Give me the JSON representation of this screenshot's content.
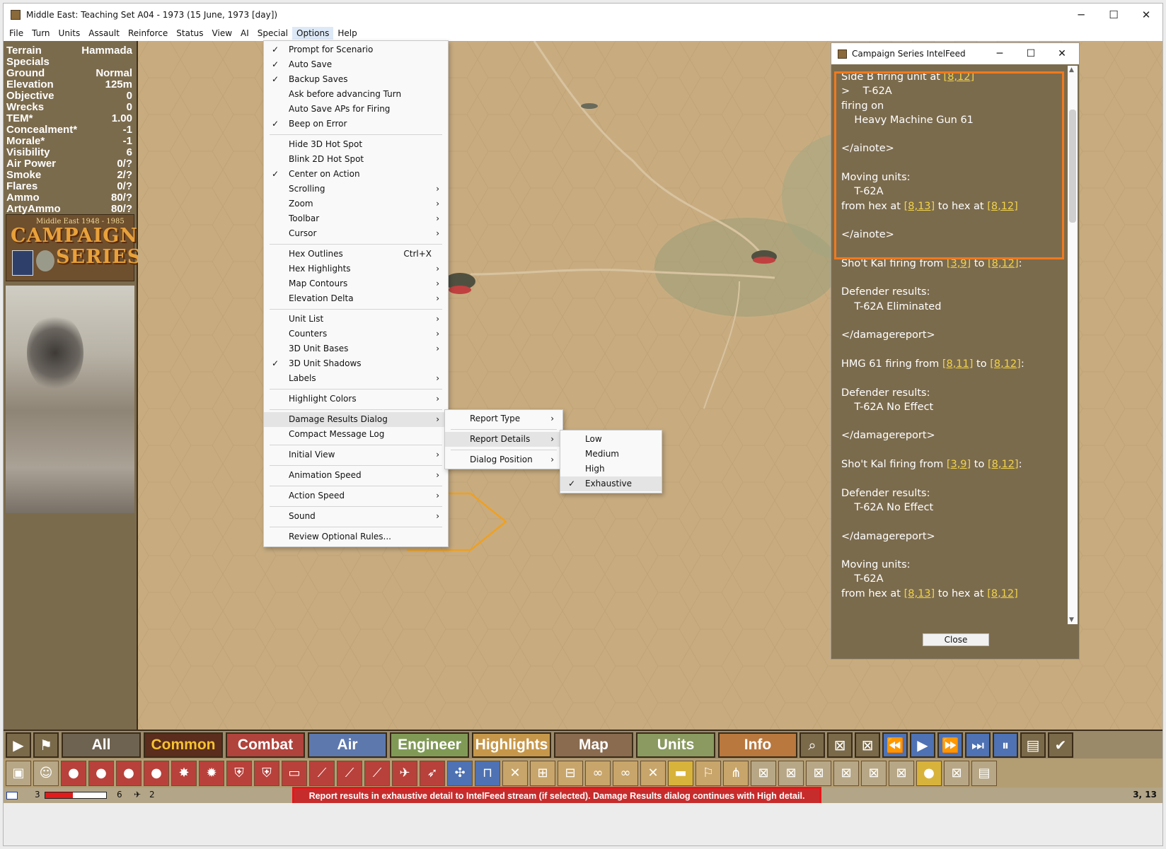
{
  "window": {
    "title": "Middle East: Teaching Set A04 - 1973 (15 June, 1973 [day])",
    "buttons": [
      "─",
      "☐",
      "✕"
    ]
  },
  "menubar": [
    "File",
    "Turn",
    "Units",
    "Assault",
    "Reinforce",
    "Status",
    "View",
    "AI",
    "Special",
    "Options",
    "Help"
  ],
  "stats": [
    {
      "label": "Terrain",
      "value": "Hammada"
    },
    {
      "label": "Specials",
      "value": ""
    },
    {
      "label": "Ground",
      "value": "Normal"
    },
    {
      "label": "Elevation",
      "value": "125m"
    },
    {
      "label": "Objective",
      "value": "0"
    },
    {
      "label": "Wrecks",
      "value": "0"
    },
    {
      "label": "TEM*",
      "value": "1.00"
    },
    {
      "label": "Concealment*",
      "value": "-1"
    },
    {
      "label": "Morale*",
      "value": "-1"
    },
    {
      "label": "Visibility",
      "value": "6"
    },
    {
      "label": "Air Power",
      "value": "0/?"
    },
    {
      "label": "Smoke",
      "value": "2/?"
    },
    {
      "label": "Flares",
      "value": "0/?"
    },
    {
      "label": "Ammo",
      "value": "80/?"
    },
    {
      "label": "ArtyAmmo",
      "value": "80/?"
    }
  ],
  "logo": {
    "line1": "Middle East 1948 - 1985",
    "line2": "CAMPAIGN",
    "line3": "SERIES"
  },
  "options_menu": [
    {
      "label": "Prompt for Scenario",
      "checked": true
    },
    {
      "label": "Auto Save",
      "checked": true
    },
    {
      "label": "Backup Saves",
      "checked": true
    },
    {
      "label": "Ask before advancing Turn"
    },
    {
      "label": "Auto Save APs for Firing"
    },
    {
      "label": "Beep on Error",
      "checked": true
    },
    {
      "sep": true
    },
    {
      "label": "Hide 3D Hot Spot"
    },
    {
      "label": "Blink 2D Hot Spot"
    },
    {
      "label": "Center on Action",
      "checked": true
    },
    {
      "label": "Scrolling",
      "submenu": true
    },
    {
      "label": "Zoom",
      "submenu": true
    },
    {
      "label": "Toolbar",
      "submenu": true
    },
    {
      "label": "Cursor",
      "submenu": true
    },
    {
      "sep": true
    },
    {
      "label": "Hex Outlines",
      "shortcut": "Ctrl+X"
    },
    {
      "label": "Hex Highlights",
      "submenu": true
    },
    {
      "label": "Map Contours",
      "submenu": true
    },
    {
      "label": "Elevation Delta",
      "submenu": true
    },
    {
      "sep": true
    },
    {
      "label": "Unit List",
      "submenu": true
    },
    {
      "label": "Counters",
      "submenu": true
    },
    {
      "label": "3D Unit Bases",
      "submenu": true
    },
    {
      "label": "3D Unit Shadows",
      "checked": true
    },
    {
      "label": "Labels",
      "submenu": true
    },
    {
      "sep": true
    },
    {
      "label": "Highlight Colors",
      "submenu": true
    },
    {
      "sep": true
    },
    {
      "label": "Damage Results Dialog",
      "submenu": true,
      "highlighted": true
    },
    {
      "label": "Compact Message Log"
    },
    {
      "sep": true
    },
    {
      "label": "Initial View",
      "submenu": true
    },
    {
      "sep": true
    },
    {
      "label": "Animation Speed",
      "submenu": true
    },
    {
      "sep": true
    },
    {
      "label": "Action Speed",
      "submenu": true
    },
    {
      "sep": true
    },
    {
      "label": "Sound",
      "submenu": true
    },
    {
      "sep": true
    },
    {
      "label": "Review Optional Rules..."
    }
  ],
  "damage_menu": [
    {
      "label": "Report Type",
      "submenu": true
    },
    {
      "sep": true
    },
    {
      "label": "Report Details",
      "submenu": true,
      "highlighted": true
    },
    {
      "sep": true
    },
    {
      "label": "Dialog Position",
      "submenu": true
    }
  ],
  "details_menu": [
    {
      "label": "Low"
    },
    {
      "label": "Medium"
    },
    {
      "label": "High"
    },
    {
      "label": "Exhaustive",
      "checked": true,
      "highlighted": true
    }
  ],
  "intel": {
    "title": "Campaign Series IntelFeed",
    "close_label": "Close",
    "lines": [
      [
        {
          "t": "Side B firing unit at "
        },
        {
          "t": "[8,12]",
          "link": true
        }
      ],
      [
        {
          "t": ">    T-62A"
        }
      ],
      [
        {
          "t": "firing on"
        }
      ],
      [
        {
          "t": "    Heavy Machine Gun 61"
        }
      ],
      [
        {
          "t": ""
        }
      ],
      [
        {
          "t": "</ainote>"
        }
      ],
      [
        {
          "t": ""
        }
      ],
      [
        {
          "t": "Moving units:"
        }
      ],
      [
        {
          "t": "    T-62A"
        }
      ],
      [
        {
          "t": "from hex at "
        },
        {
          "t": "[8,13]",
          "link": true
        },
        {
          "t": " to hex at "
        },
        {
          "t": "[8,12]",
          "link": true
        }
      ],
      [
        {
          "t": ""
        }
      ],
      [
        {
          "t": "</ainote>"
        }
      ],
      [
        {
          "t": ""
        }
      ],
      [
        {
          "t": "Sho't Kal firing from "
        },
        {
          "t": "[3,9]",
          "link": true
        },
        {
          "t": " to "
        },
        {
          "t": "[8,12]",
          "link": true
        },
        {
          "t": ":"
        }
      ],
      [
        {
          "t": ""
        }
      ],
      [
        {
          "t": "Defender results:"
        }
      ],
      [
        {
          "t": "    T-62A Eliminated"
        }
      ],
      [
        {
          "t": ""
        }
      ],
      [
        {
          "t": "</damagereport>"
        }
      ],
      [
        {
          "t": ""
        }
      ],
      [
        {
          "t": "HMG 61 firing from "
        },
        {
          "t": "[8,11]",
          "link": true
        },
        {
          "t": " to "
        },
        {
          "t": "[8,12]",
          "link": true
        },
        {
          "t": ":"
        }
      ],
      [
        {
          "t": ""
        }
      ],
      [
        {
          "t": "Defender results:"
        }
      ],
      [
        {
          "t": "    T-62A No Effect"
        }
      ],
      [
        {
          "t": ""
        }
      ],
      [
        {
          "t": "</damagereport>"
        }
      ],
      [
        {
          "t": ""
        }
      ],
      [
        {
          "t": "Sho't Kal firing from "
        },
        {
          "t": "[3,9]",
          "link": true
        },
        {
          "t": " to "
        },
        {
          "t": "[8,12]",
          "link": true
        },
        {
          "t": ":"
        }
      ],
      [
        {
          "t": ""
        }
      ],
      [
        {
          "t": "Defender results:"
        }
      ],
      [
        {
          "t": "    T-62A No Effect"
        }
      ],
      [
        {
          "t": ""
        }
      ],
      [
        {
          "t": "</damagereport>"
        }
      ],
      [
        {
          "t": ""
        }
      ],
      [
        {
          "t": "Moving units:"
        }
      ],
      [
        {
          "t": "    T-62A"
        }
      ],
      [
        {
          "t": "from hex at "
        },
        {
          "t": "[8,13]",
          "link": true
        },
        {
          "t": " to hex at "
        },
        {
          "t": "[8,12]",
          "link": true
        }
      ]
    ]
  },
  "tabs": [
    {
      "label": "All",
      "color": "#6e6250",
      "text": "#ffffff"
    },
    {
      "label": "Common",
      "color": "#5a2d1c",
      "text": "#f6c230"
    },
    {
      "label": "Combat",
      "color": "#b0433c",
      "text": "#ffffff"
    },
    {
      "label": "Air",
      "color": "#5d78ad",
      "text": "#ffffff"
    },
    {
      "label": "Engineer",
      "color": "#809a56",
      "text": "#ffffff"
    },
    {
      "label": "Highlights",
      "color": "#c6974a",
      "text": "#ffffff"
    },
    {
      "label": "Map",
      "color": "#8a6b4f",
      "text": "#ffffff"
    },
    {
      "label": "Units",
      "color": "#8a9a60",
      "text": "#ffffff"
    },
    {
      "label": "Info",
      "color": "#b9783e",
      "text": "#ffffff"
    }
  ],
  "status": {
    "left_num": "3",
    "mid_num": "6",
    "small_num": "2",
    "progress": 0.45,
    "hint": "Report results in exhaustive detail to IntelFeed stream (if selected). Damage Results dialog continues with High detail.",
    "coords": "3, 13"
  }
}
